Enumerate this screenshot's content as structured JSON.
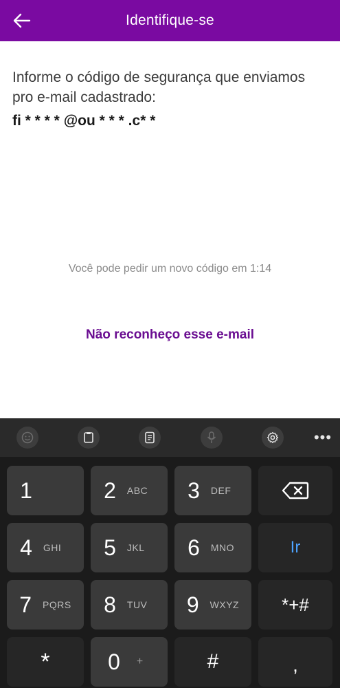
{
  "header": {
    "title": "Identifique-se",
    "back_icon": "arrow-left-icon",
    "background": "#7a0aa1"
  },
  "main": {
    "instruction": "Informe o código de segurança que enviamos pro e-mail cadastrado:",
    "masked_email": "fi * * * * @ou * * * .c* *",
    "resend_countdown": "Você pode pedir um novo código em 1:14",
    "unknown_email_link": "Não reconheço esse e-mail",
    "link_color": "#6a0d91"
  },
  "keyboard": {
    "toolbar_icons": [
      "emoji-icon",
      "clipboard-icon",
      "text-note-icon",
      "microphone-icon",
      "settings-gear-icon",
      "more-options-icon"
    ],
    "keys": [
      {
        "digit": "1",
        "letters": ""
      },
      {
        "digit": "2",
        "letters": "ABC"
      },
      {
        "digit": "3",
        "letters": "DEF"
      },
      {
        "digit": "4",
        "letters": "GHI"
      },
      {
        "digit": "5",
        "letters": "JKL"
      },
      {
        "digit": "6",
        "letters": "MNO"
      },
      {
        "digit": "7",
        "letters": "PQRS"
      },
      {
        "digit": "8",
        "letters": "TUV"
      },
      {
        "digit": "9",
        "letters": "WXYZ"
      },
      {
        "digit": "0",
        "letters": "+"
      }
    ],
    "star_label": "*",
    "hash_label": "#",
    "go_label": "Ir",
    "symbols_label": "*+#",
    "comma_label": ",",
    "go_color": "#4da3ff"
  }
}
